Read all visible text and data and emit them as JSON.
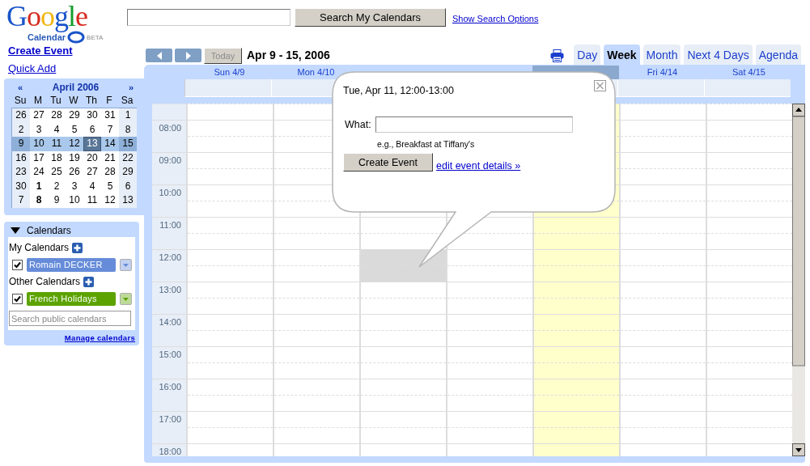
{
  "header": {
    "logo": {
      "wordmark": "Google",
      "product": "Calendar",
      "badge": "BETA"
    },
    "search": {
      "button": "Search My Calendars",
      "link": "Show Search Options"
    }
  },
  "sidebar": {
    "links": [
      "Create Event",
      "Quick Add"
    ],
    "mini_calendar": {
      "prev": "«",
      "title": "April 2006",
      "next": "»",
      "weekdays": [
        "Su",
        "M",
        "Tu",
        "W",
        "Th",
        "F",
        "Sa"
      ],
      "weeks": [
        {
          "selected": false,
          "days": [
            {
              "label": "26",
              "today": false,
              "bold": false
            },
            {
              "label": "27",
              "today": false,
              "bold": false
            },
            {
              "label": "28",
              "today": false,
              "bold": false
            },
            {
              "label": "29",
              "today": false,
              "bold": false
            },
            {
              "label": "30",
              "today": false,
              "bold": false
            },
            {
              "label": "31",
              "today": false,
              "bold": false
            },
            {
              "label": "1",
              "today": false,
              "bold": false
            }
          ]
        },
        {
          "selected": false,
          "days": [
            {
              "label": "2",
              "today": false,
              "bold": false
            },
            {
              "label": "3",
              "today": false,
              "bold": false
            },
            {
              "label": "4",
              "today": false,
              "bold": false
            },
            {
              "label": "5",
              "today": false,
              "bold": false
            },
            {
              "label": "6",
              "today": false,
              "bold": false
            },
            {
              "label": "7",
              "today": false,
              "bold": false
            },
            {
              "label": "8",
              "today": false,
              "bold": false
            }
          ]
        },
        {
          "selected": true,
          "days": [
            {
              "label": "9",
              "today": false,
              "bold": false
            },
            {
              "label": "10",
              "today": false,
              "bold": false
            },
            {
              "label": "11",
              "today": false,
              "bold": false
            },
            {
              "label": "12",
              "today": false,
              "bold": false
            },
            {
              "label": "13",
              "today": true,
              "bold": false
            },
            {
              "label": "14",
              "today": false,
              "bold": false
            },
            {
              "label": "15",
              "today": false,
              "bold": false
            }
          ]
        },
        {
          "selected": false,
          "days": [
            {
              "label": "16",
              "today": false,
              "bold": false
            },
            {
              "label": "17",
              "today": false,
              "bold": false
            },
            {
              "label": "18",
              "today": false,
              "bold": false
            },
            {
              "label": "19",
              "today": false,
              "bold": false
            },
            {
              "label": "20",
              "today": false,
              "bold": false
            },
            {
              "label": "21",
              "today": false,
              "bold": false
            },
            {
              "label": "22",
              "today": false,
              "bold": false
            }
          ]
        },
        {
          "selected": false,
          "days": [
            {
              "label": "23",
              "today": false,
              "bold": false
            },
            {
              "label": "24",
              "today": false,
              "bold": false
            },
            {
              "label": "25",
              "today": false,
              "bold": false
            },
            {
              "label": "26",
              "today": false,
              "bold": false
            },
            {
              "label": "27",
              "today": false,
              "bold": false
            },
            {
              "label": "28",
              "today": false,
              "bold": false
            },
            {
              "label": "29",
              "today": false,
              "bold": false
            }
          ]
        },
        {
          "selected": false,
          "days": [
            {
              "label": "30",
              "today": false,
              "bold": false
            },
            {
              "label": "1",
              "today": false,
              "bold": true
            },
            {
              "label": "2",
              "today": false,
              "bold": false
            },
            {
              "label": "3",
              "today": false,
              "bold": false
            },
            {
              "label": "4",
              "today": false,
              "bold": false
            },
            {
              "label": "5",
              "today": false,
              "bold": false
            },
            {
              "label": "6",
              "today": false,
              "bold": false
            }
          ]
        },
        {
          "selected": false,
          "days": [
            {
              "label": "7",
              "today": false,
              "bold": false
            },
            {
              "label": "8",
              "today": false,
              "bold": true
            },
            {
              "label": "9",
              "today": false,
              "bold": false
            },
            {
              "label": "10",
              "today": false,
              "bold": false
            },
            {
              "label": "11",
              "today": false,
              "bold": false
            },
            {
              "label": "12",
              "today": false,
              "bold": false
            },
            {
              "label": "13",
              "today": false,
              "bold": false
            }
          ]
        }
      ]
    },
    "calendars": {
      "title": "Calendars",
      "expanded": true,
      "groups": [
        {
          "label": "My Calendars",
          "items": [
            {
              "name": "Romain DECKER",
              "checked": true,
              "color": "#668cd9"
            }
          ]
        },
        {
          "label": "Other Calendars",
          "items": [
            {
              "name": "French Holidays",
              "checked": true,
              "color": "#5ca300"
            }
          ]
        }
      ],
      "search_placeholder": "Search public calendars",
      "manage_link": "Manage calendars"
    }
  },
  "main": {
    "nav": {
      "today": "Today",
      "today_disabled": true,
      "range": "Apr 9 - 15, 2006"
    },
    "views": [
      {
        "label": "Day",
        "selected": false
      },
      {
        "label": "Week",
        "selected": true
      },
      {
        "label": "Month",
        "selected": false
      },
      {
        "label": "Next 4 Days",
        "selected": false
      },
      {
        "label": "Agenda",
        "selected": false
      }
    ],
    "days": [
      {
        "label": "Sun 4/9",
        "today": false,
        "selected": false
      },
      {
        "label": "Mon 4/10",
        "today": false,
        "selected": false
      },
      {
        "today": false,
        "selected": true
      },
      {
        "today": false,
        "selected": false
      },
      {
        "today": true,
        "selected": false
      },
      {
        "label": "Fri 4/14",
        "today": false,
        "selected": false
      },
      {
        "label": "Sat 4/15",
        "today": false,
        "selected": false
      }
    ],
    "hours": [
      {
        "label": "08:00",
        "selected": false
      },
      {
        "label": "09:00",
        "selected": false
      },
      {
        "label": "10:00",
        "selected": false
      },
      {
        "label": "11:00",
        "selected": false
      },
      {
        "label": "12:00",
        "selected": true
      },
      {
        "label": "13:00",
        "selected": false
      },
      {
        "label": "14:00",
        "selected": false
      },
      {
        "label": "15:00",
        "selected": false
      },
      {
        "label": "16:00",
        "selected": false
      },
      {
        "label": "17:00",
        "selected": false
      },
      {
        "label": "18:00",
        "selected": false
      }
    ],
    "popup": {
      "title": "Tue, Apr 11, 12:00-13:00",
      "what_label": "What:",
      "hint": "e.g., Breakfast at Tiffany's",
      "button": "Create Event",
      "link": "edit event details »"
    }
  }
}
